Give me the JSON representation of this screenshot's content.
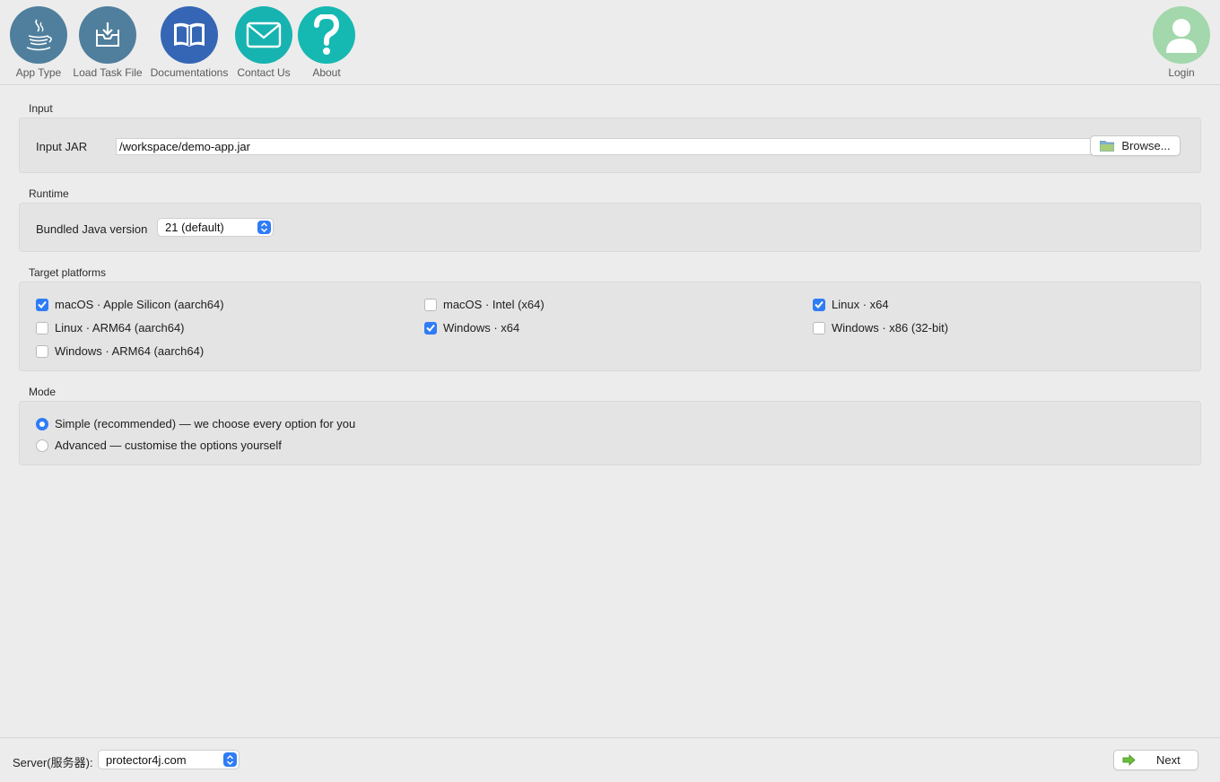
{
  "toolbar": {
    "items": [
      {
        "label": "App Type",
        "icon": "java-cup-icon",
        "color": "#4f7f9c"
      },
      {
        "label": "Load Task File",
        "icon": "download-tray-icon",
        "color": "#4f7f9c"
      },
      {
        "label": "Documentations",
        "icon": "book-icon",
        "color": "#3566b5"
      },
      {
        "label": "Contact Us",
        "icon": "envelope-icon",
        "color": "#17b3b1"
      },
      {
        "label": "About",
        "icon": "question-icon",
        "color": "#16b8b2"
      }
    ],
    "login": {
      "label": "Login",
      "icon": "user-icon",
      "color": "#a3d7ac"
    }
  },
  "input": {
    "section_title": "Input",
    "jar_label": "Input JAR",
    "jar_value": "/workspace/demo-app.jar",
    "browse_label": "Browse..."
  },
  "runtime": {
    "section_title": "Runtime",
    "java_label": "Bundled Java version",
    "java_value": "21 (default)"
  },
  "platforms": {
    "section_title": "Target platforms",
    "items": [
      {
        "label": "macOS · Apple Silicon (aarch64)",
        "checked": true
      },
      {
        "label": "macOS · Intel (x64)",
        "checked": false
      },
      {
        "label": "Linux · x64",
        "checked": true
      },
      {
        "label": "Linux · ARM64 (aarch64)",
        "checked": false
      },
      {
        "label": "Windows · x64",
        "checked": true
      },
      {
        "label": "Windows · x86 (32-bit)",
        "checked": false
      },
      {
        "label": "Windows · ARM64 (aarch64)",
        "checked": false
      }
    ]
  },
  "mode": {
    "section_title": "Mode",
    "options": [
      {
        "label": "Simple (recommended) — we choose every option for you",
        "selected": true
      },
      {
        "label": "Advanced — customise the options yourself",
        "selected": false
      }
    ]
  },
  "footer": {
    "server_label": "Server(服务器):",
    "server_value": "protector4j.com",
    "next_label": "Next"
  },
  "colors": {
    "accent": "#2f7cf6"
  }
}
